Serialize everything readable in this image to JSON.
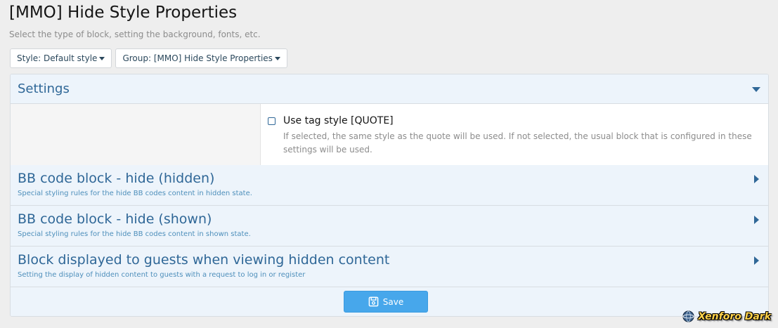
{
  "page": {
    "title": "[MMO] Hide Style Properties",
    "description": "Select the type of block, setting the background, fonts, etc."
  },
  "filters": {
    "style_label": "Style: Default style",
    "group_label": "Group: [MMO] Hide Style Properties"
  },
  "sections": {
    "settings": {
      "title": "Settings",
      "expanded": true,
      "option": {
        "label": "Use tag style [QUOTE]",
        "checked": false,
        "hint": "If selected, the same style as the quote will be used. If not selected, the usual block that is configured in these settings will be used."
      }
    },
    "hidden": {
      "title": "BB code block - hide (hidden)",
      "description": "Special styling rules for the hide BB codes content in hidden state.",
      "expanded": false
    },
    "shown": {
      "title": "BB code block - hide (shown)",
      "description": "Special styling rules for the hide BB codes content in shown state.",
      "expanded": false
    },
    "guests": {
      "title": "Block displayed to guests when viewing hidden content",
      "description": "Setting the display of hidden content to guests with a request to log in or register",
      "expanded": false
    }
  },
  "actions": {
    "save_label": "Save",
    "save_icon": "floppy-disk-icon"
  },
  "watermark": {
    "text": "Xenforo Dark"
  },
  "colors": {
    "accent": "#2f6797",
    "header_bg": "#edf4fb",
    "button_primary": "#47a7eb",
    "page_bg": "#eeeeee"
  }
}
